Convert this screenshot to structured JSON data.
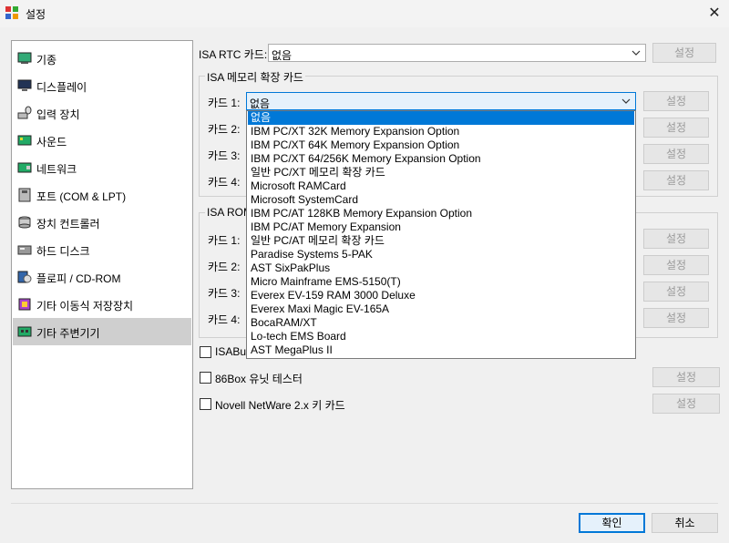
{
  "window": {
    "title": "설정",
    "icon": "app-icon",
    "close_icon": "close-icon"
  },
  "sidebar": {
    "items": [
      {
        "label": "기종",
        "icon": "machine-icon",
        "selected": false
      },
      {
        "label": "디스플레이",
        "icon": "display-icon",
        "selected": false
      },
      {
        "label": "입력 장치",
        "icon": "input-devices-icon",
        "selected": false
      },
      {
        "label": "사운드",
        "icon": "sound-icon",
        "selected": false
      },
      {
        "label": "네트워크",
        "icon": "network-icon",
        "selected": false
      },
      {
        "label": "포트 (COM & LPT)",
        "icon": "ports-icon",
        "selected": false
      },
      {
        "label": "장치 컨트롤러",
        "icon": "storage-controllers-icon",
        "selected": false
      },
      {
        "label": "하드 디스크",
        "icon": "hard-disk-icon",
        "selected": false
      },
      {
        "label": "플로피 / CD-ROM",
        "icon": "floppy-cdrom-icon",
        "selected": false
      },
      {
        "label": "기타 이동식 저장장치",
        "icon": "removable-storage-icon",
        "selected": false
      },
      {
        "label": "기타 주변기기",
        "icon": "other-peripherals-icon",
        "selected": true
      }
    ]
  },
  "main": {
    "isa_rtc": {
      "label": "ISA RTC 카드:",
      "value": "없음",
      "button": "설정"
    },
    "isa_memory_group": {
      "title": "ISA 메모리 확장 카드",
      "rows": [
        {
          "label": "카드 1:",
          "value": "없음",
          "button": "설정"
        },
        {
          "label": "카드 2:",
          "button": "설정"
        },
        {
          "label": "카드 3:",
          "button": "설정"
        },
        {
          "label": "카드 4:",
          "button": "설정"
        }
      ]
    },
    "isa_rom_group": {
      "title": "ISA ROM",
      "rows": [
        {
          "label": "카드 1:",
          "button": "설정"
        },
        {
          "label": "카드 2:",
          "button": "설정"
        },
        {
          "label": "카드 3:",
          "button": "설정"
        },
        {
          "label": "카드 4:",
          "button": "설정"
        }
      ]
    },
    "checkboxes": [
      {
        "label": "ISABugger",
        "visible_text": "ISABug",
        "checked": false
      },
      {
        "label": "86Box 유닛 테스터",
        "checked": false,
        "button": "설정"
      },
      {
        "label": "Novell NetWare 2.x 키 카드",
        "checked": false,
        "button": "설정"
      }
    ]
  },
  "dropdown": {
    "selected_index": 0,
    "options": [
      "없음",
      "IBM PC/XT 32K Memory Expansion Option",
      "IBM PC/XT 64K Memory Expansion Option",
      "IBM PC/XT 64/256K Memory Expansion Option",
      "일반 PC/XT 메모리 확장 카드",
      "Microsoft RAMCard",
      "Microsoft SystemCard",
      "IBM PC/AT 128KB Memory Expansion Option",
      "IBM PC/AT Memory Expansion",
      "일반 PC/AT 메모리 확장 카드",
      "Paradise Systems 5-PAK",
      "AST SixPakPlus",
      "Micro Mainframe EMS-5150(T)",
      "Everex EV-159 RAM 3000 Deluxe",
      "Everex Maxi Magic EV-165A",
      "BocaRAM/XT",
      "Lo-tech EMS Board",
      "AST MegaPlus II"
    ]
  },
  "footer": {
    "ok": "확인",
    "cancel": "취소"
  },
  "colors": {
    "accent": "#0078d7",
    "selected_sidebar": "#cfcfcf",
    "dropdown_highlight": "#0078d7"
  }
}
